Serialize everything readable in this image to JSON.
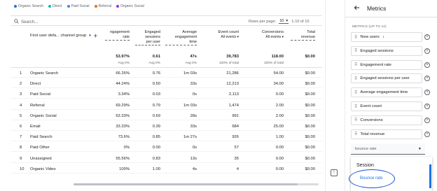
{
  "legend": [
    {
      "label": "Organic Search",
      "color": "#1a73e8"
    },
    {
      "label": "Direct",
      "color": "#12b5cb"
    },
    {
      "label": "Paid Social",
      "color": "#4285f4"
    },
    {
      "label": "Referral",
      "color": "#e8710a"
    },
    {
      "label": "Organic Social",
      "color": "#9334e6"
    }
  ],
  "toolbar": {
    "search_placeholder": "Search...",
    "rows_per_page_label": "Rows per page:",
    "rows_per_page_value": "10",
    "range": "1-10 of 10"
  },
  "columns": {
    "dimension": "First user defa... channel group",
    "engagement_rate": [
      "ngagement",
      "rate"
    ],
    "engaged_sessions": [
      "Engaged",
      "sessions",
      "per user"
    ],
    "avg_engagement": [
      "Average",
      "engagement",
      "time"
    ],
    "event_count": [
      "Event count"
    ],
    "event_count_sub": "All events",
    "conversions": [
      "Conversions"
    ],
    "conversions_sub": "All events",
    "total_revenue": [
      "Total",
      "revenue"
    ]
  },
  "totals": {
    "engagement_rate": "53.97%",
    "engagement_rate_sub": "Avg 0%",
    "engaged_sessions": "0.61",
    "engaged_sessions_sub": "Avg 0%",
    "avg_engagement": "47s",
    "avg_engagement_sub": "Avg 0%",
    "event_count": "39,783",
    "event_count_sub": "100% of total",
    "conversions": "118.00",
    "conversions_sub": "100% of total",
    "total_revenue": "$0.00"
  },
  "rows": [
    {
      "n": "1",
      "channel": "Organic Search",
      "er": "66.26%",
      "es": "0.76",
      "aet": "1m 03s",
      "ec": "21,286",
      "cv": "54.00",
      "rev": "$0.00"
    },
    {
      "n": "2",
      "channel": "Direct",
      "er": "44.24%",
      "es": "0.50",
      "aet": "33s",
      "ec": "12,213",
      "cv": "34.00",
      "rev": "$0.00"
    },
    {
      "n": "3",
      "channel": "Paid Social",
      "er": "3.34%",
      "es": "0.03",
      "aet": "0s",
      "ec": "2,113",
      "cv": "0.00",
      "rev": "$0.00"
    },
    {
      "n": "4",
      "channel": "Referral",
      "er": "69.29%",
      "es": "0.79",
      "aet": "1m 03s",
      "ec": "1,474",
      "cv": "2.00",
      "rev": "$0.00"
    },
    {
      "n": "5",
      "channel": "Organic Social",
      "er": "63.33%",
      "es": "0.69",
      "aet": "28s",
      "ec": "991",
      "cv": "2.00",
      "rev": "$0.00"
    },
    {
      "n": "6",
      "channel": "Email",
      "er": "33.33%",
      "es": "0.39",
      "aet": "33s",
      "ec": "684",
      "cv": "25.00",
      "rev": "$0.00"
    },
    {
      "n": "7",
      "channel": "Paid Search",
      "er": "73.6%",
      "es": "0.85",
      "aet": "1m 27s",
      "ec": "926",
      "cv": "1.00",
      "rev": "$0.00"
    },
    {
      "n": "8",
      "channel": "Paid Other",
      "er": "0%",
      "es": "0.00",
      "aet": "0s",
      "ec": "57",
      "cv": "0.00",
      "rev": "$0.00"
    },
    {
      "n": "9",
      "channel": "Unassigned",
      "er": "55.56%",
      "es": "0.83",
      "aet": "13s",
      "ec": "35",
      "cv": "0.00",
      "rev": "$0.00"
    },
    {
      "n": "10",
      "channel": "Organic Video",
      "er": "100%",
      "es": "1.00",
      "aet": "4s",
      "ec": "4",
      "cv": "0.00",
      "rev": "$0.00"
    }
  ],
  "panel": {
    "title": "Metrics",
    "subtitle": "METRICS (UP TO 12)",
    "metrics": [
      "New users",
      "Engaged sessions",
      "Engagement rate",
      "Engaged sessions per user",
      "Average engagement time",
      "Event count",
      "Conversions",
      "Total revenue"
    ],
    "dropdown_value": "bounce rate",
    "menu_category": "Session",
    "menu_option": "Bounce rate"
  }
}
